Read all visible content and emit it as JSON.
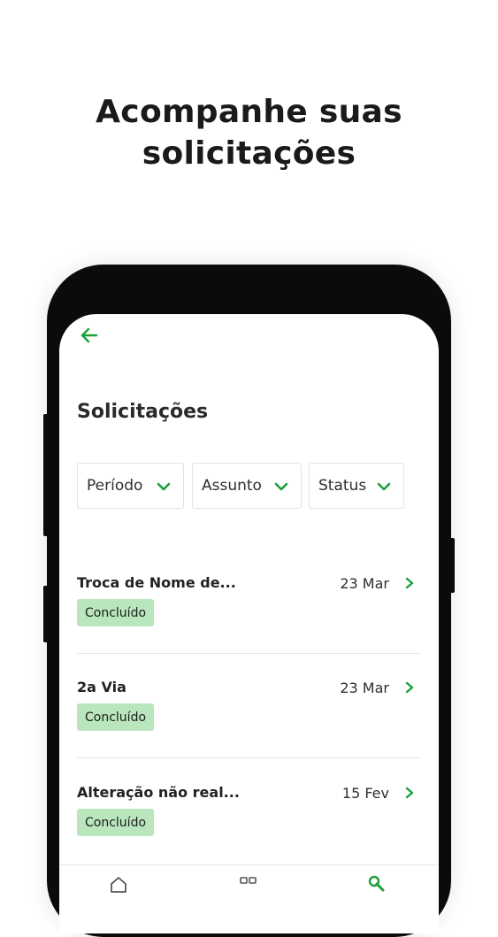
{
  "headline": {
    "line1": "Acompanhe suas",
    "line2": "solicitações"
  },
  "screen": {
    "title": "Solicitações"
  },
  "filters": [
    {
      "label": "Período"
    },
    {
      "label": "Assunto"
    },
    {
      "label": "Status"
    }
  ],
  "requests": [
    {
      "title": "Troca de Nome de...",
      "date": "23 Mar",
      "status": "Concluído"
    },
    {
      "title": "2a Via",
      "date": "23 Mar",
      "status": "Concluído"
    },
    {
      "title": "Alteração não real...",
      "date": "15 Fev",
      "status": "Concluído"
    }
  ],
  "icons": {
    "back": "arrow-left-icon",
    "chevron": "chevron-down-icon",
    "arrow": "chevron-right-icon",
    "nav": [
      "home-icon",
      "grid-icon",
      "wrench-icon"
    ]
  },
  "colors": {
    "accent": "#1aa13a",
    "badge_bg": "#b9e6bd",
    "text": "#222222"
  }
}
